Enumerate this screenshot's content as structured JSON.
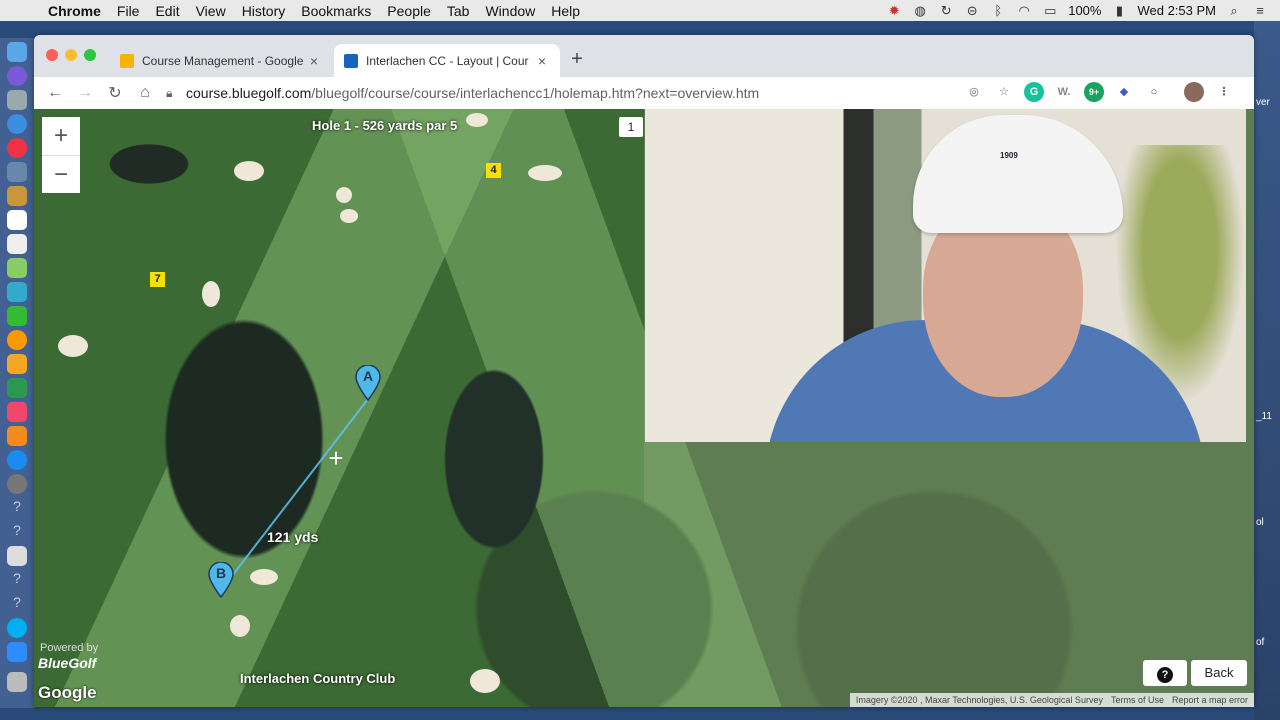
{
  "menubar": {
    "app": "Chrome",
    "items": [
      "File",
      "Edit",
      "View",
      "History",
      "Bookmarks",
      "People",
      "Tab",
      "Window",
      "Help"
    ],
    "battery": "100%",
    "clock": "Wed 2:53 PM"
  },
  "tabs": [
    {
      "title": "Course Management - Google",
      "favicon_color": "#f4b400",
      "active": false
    },
    {
      "title": "Interlachen CC - Layout | Cour",
      "favicon_color": "#1565c0",
      "active": true
    }
  ],
  "address": {
    "host": "course.bluegolf.com",
    "path": "/bluegolf/course/course/interlachencc1/holemap.htm?next=overview.htm"
  },
  "extensions": [
    {
      "name": "grammarly-icon",
      "label": "G",
      "color": "#15c39a"
    },
    {
      "name": "w-extension-icon",
      "label": "W.",
      "color": "#888888"
    },
    {
      "name": "badge-extension-icon",
      "label": "9+",
      "color": "#1aa260"
    },
    {
      "name": "shield-extension-icon",
      "label": "◆",
      "color": "#3a5ad8"
    },
    {
      "name": "circle-extension-icon",
      "label": "○",
      "color": "#444444"
    }
  ],
  "map": {
    "hole_title": "Hole 1 - 526 yards par 5",
    "hole_button": "1",
    "hole_markers": [
      {
        "label": "4"
      },
      {
        "label": "7"
      }
    ],
    "marker_a": "A",
    "marker_b": "B",
    "distance": "121 yds",
    "powered_by": "Powered by",
    "brand": "BlueGolf",
    "google": "Google",
    "club_name": "Interlachen Country Club",
    "attribution": [
      "Imagery ©2020 , Maxar Technologies, U.S. Geological Survey",
      "Terms of Use",
      "Report a map error"
    ],
    "help_label": "?",
    "back_label": "Back",
    "zoom_in": "+",
    "zoom_out": "−"
  },
  "video": {
    "cap_text": "1909"
  },
  "desktop_labels": [
    "ver",
    "_11",
    "ol",
    "of"
  ],
  "colors": {
    "chrome_tab_strip": "#dee1e6",
    "map_marker": "#4fb8e8",
    "hole_number_bg": "#f5e000"
  }
}
